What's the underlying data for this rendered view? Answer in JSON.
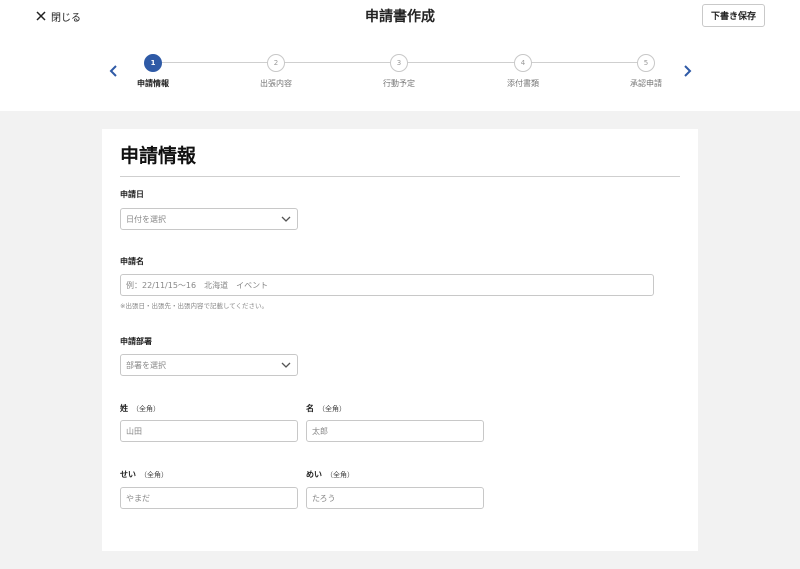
{
  "header": {
    "close_label": "閉じる",
    "title": "申請書作成",
    "draft_label": "下書き保存"
  },
  "steps": [
    {
      "num": "1",
      "label": "申請情報",
      "active": true
    },
    {
      "num": "2",
      "label": "出張内容",
      "active": false
    },
    {
      "num": "3",
      "label": "行動予定",
      "active": false
    },
    {
      "num": "4",
      "label": "添付書類",
      "active": false
    },
    {
      "num": "5",
      "label": "承認申請",
      "active": false
    }
  ],
  "form": {
    "section_title": "申請情報",
    "date": {
      "label": "申請日",
      "placeholder": "日付を選択"
    },
    "name": {
      "label": "申請名",
      "placeholder": "例：22/11/15〜16　北海道　イベント",
      "help": "※出張日・出張先・出張内容で記載してください。"
    },
    "dept": {
      "label": "申請部署",
      "placeholder": "部署を選択"
    },
    "last_name": {
      "label": "姓",
      "sub": "（全角）",
      "placeholder": "山田"
    },
    "first_name": {
      "label": "名",
      "sub": "（全角）",
      "placeholder": "太郎"
    },
    "last_kana": {
      "label": "せい",
      "sub": "（全角）",
      "placeholder": "やまだ"
    },
    "first_kana": {
      "label": "めい",
      "sub": "（全角）",
      "placeholder": "たろう"
    }
  },
  "colors": {
    "accent": "#2f5aa6",
    "background": "#f2f2f2",
    "card": "#ffffff",
    "border": "#c8c8c8"
  }
}
